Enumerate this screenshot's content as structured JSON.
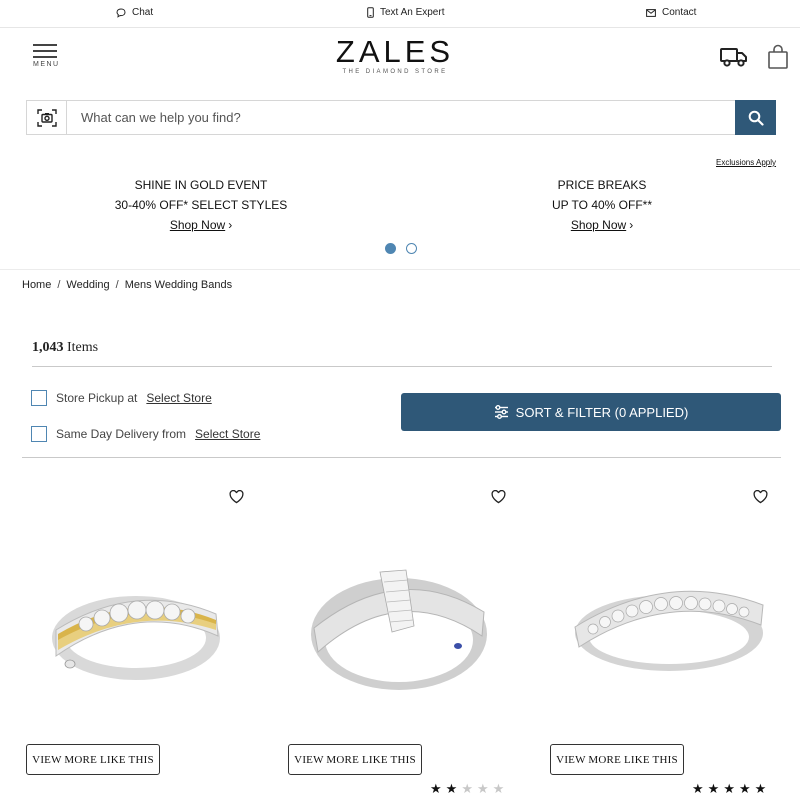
{
  "topbar": {
    "chat": "Chat",
    "text_expert": "Text An Expert",
    "contact": "Contact"
  },
  "header": {
    "menu_label": "MENU",
    "logo_word": "ZALES",
    "logo_tagline": "THE DIAMOND STORE"
  },
  "search": {
    "placeholder": "What can we help you find?"
  },
  "promo": {
    "exclusions": "Exclusions Apply",
    "slides": [
      {
        "line1": "SHINE IN GOLD EVENT",
        "line2": "30-40% OFF* SELECT STYLES",
        "cta": "Shop Now"
      },
      {
        "line1": "PRICE BREAKS",
        "line2": "UP TO 40% OFF**",
        "cta": "Shop Now"
      }
    ]
  },
  "breadcrumb": [
    "Home",
    "Wedding",
    "Mens Wedding Bands"
  ],
  "results": {
    "count": "1,043",
    "count_label": "Items"
  },
  "filters": {
    "store_pickup_label": "Store Pickup at",
    "same_day_label": "Same Day Delivery from",
    "select_store": "Select Store",
    "sort_filter": "SORT & FILTER (0 APPLIED)"
  },
  "products": [
    {
      "cta": "VIEW MORE LIKE THIS",
      "rating": null
    },
    {
      "cta": "VIEW MORE LIKE THIS",
      "rating": 2
    },
    {
      "cta": "VIEW MORE LIKE THIS",
      "rating": 5
    }
  ],
  "colors": {
    "accent": "#2f5878",
    "dot": "#4f86b2",
    "gold": "#d9b44a"
  }
}
